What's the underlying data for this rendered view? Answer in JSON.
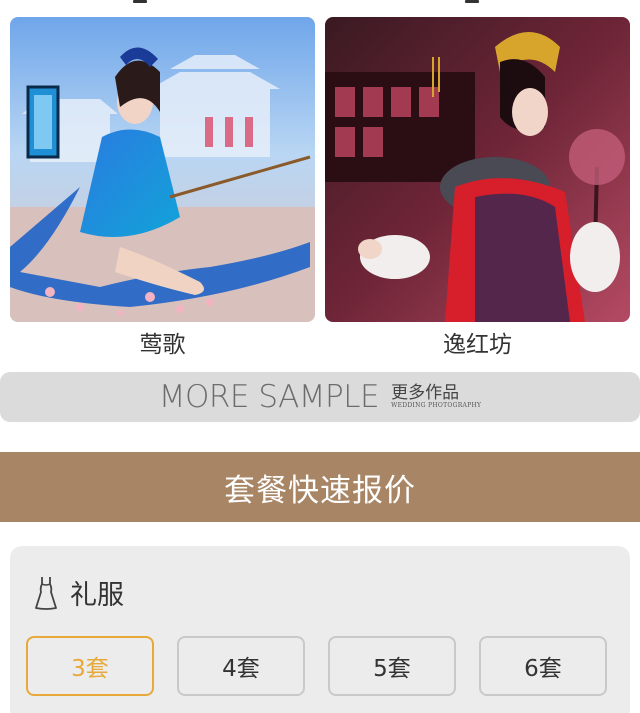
{
  "gallery": {
    "items": [
      {
        "caption": "莺歌",
        "photo_icon": "blue-costume-photo"
      },
      {
        "caption": "逸红坊",
        "photo_icon": "red-costume-photo"
      }
    ]
  },
  "more_sample": {
    "title_en": "MORE SAMPLE",
    "title_cn": "更多作品",
    "subtitle": "WEDDING PHOTOGRAPHY"
  },
  "quote": {
    "title": "套餐快速报价"
  },
  "package": {
    "label": "礼服",
    "icon": "dress-icon",
    "options": [
      "3套",
      "4套",
      "5套",
      "6套"
    ],
    "selected_index": 0
  },
  "colors": {
    "accent": "#e8a93a",
    "header_bg": "#a88565",
    "more_bar_bg": "#dcdbdc",
    "panel_bg": "#ececec"
  }
}
